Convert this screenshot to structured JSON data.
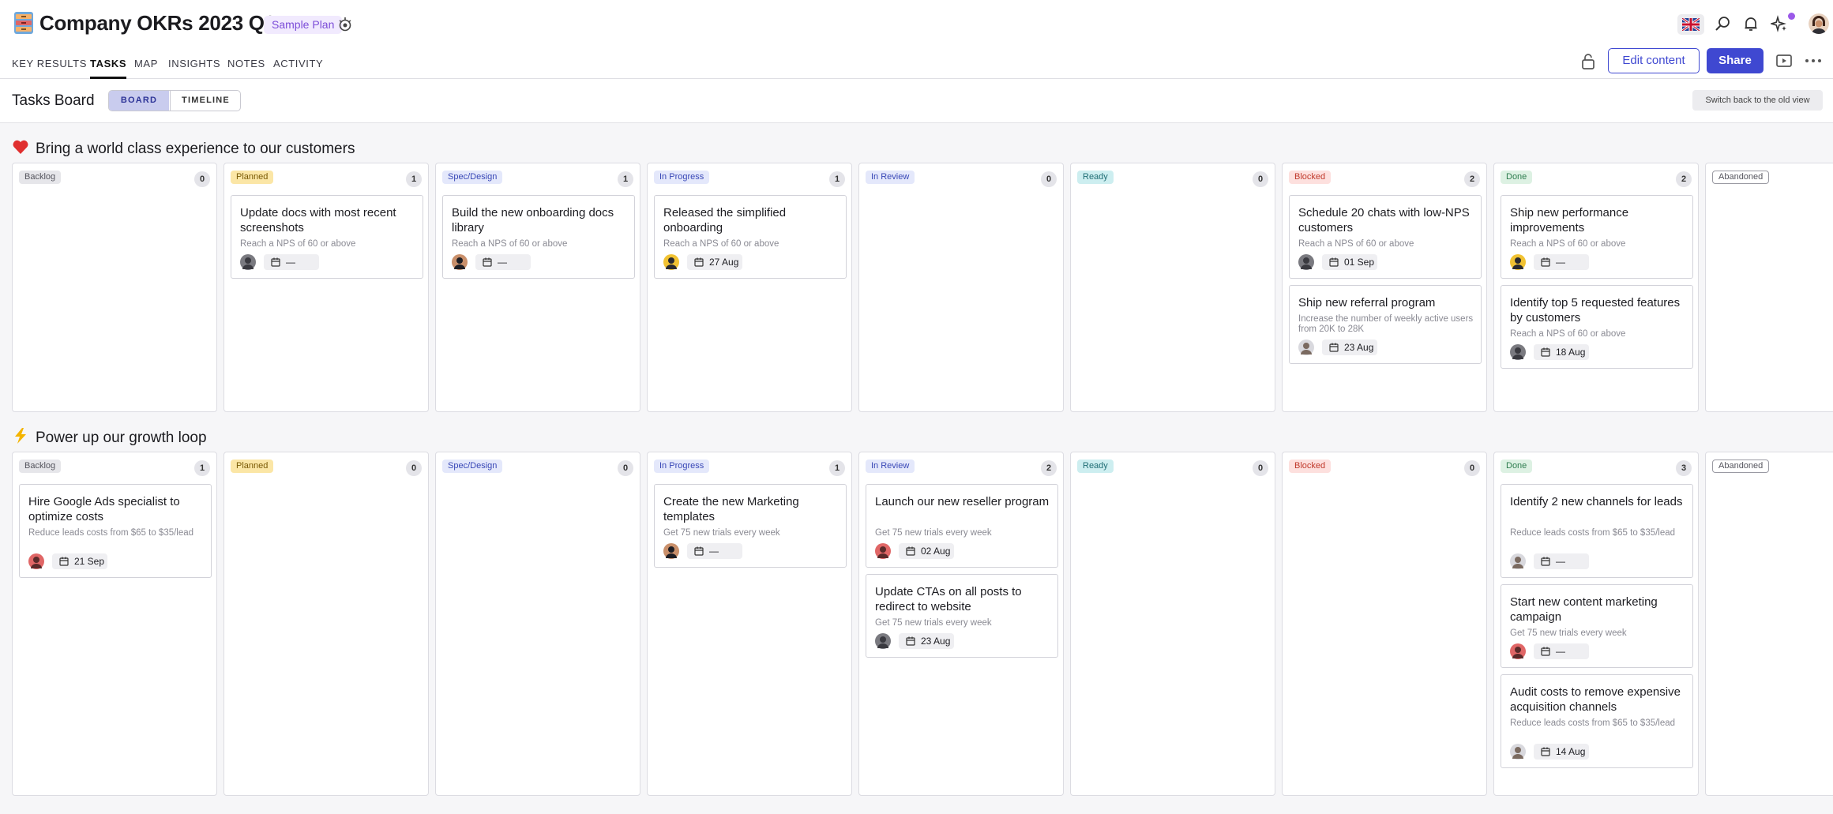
{
  "header": {
    "plan_emoji": "file-cabinet-icon",
    "title": "Company OKRs 2023 Q3",
    "badge": "Sample Plan"
  },
  "tabs": [
    {
      "label": "KEY RESULTS"
    },
    {
      "label": "TASKS",
      "active": true
    },
    {
      "label": "MAP"
    },
    {
      "label": "INSIGHTS"
    },
    {
      "label": "NOTES"
    },
    {
      "label": "ACTIVITY"
    }
  ],
  "actions": {
    "edit": "Edit content",
    "share": "Share"
  },
  "board": {
    "title": "Tasks Board",
    "views": [
      {
        "label": "BOARD",
        "active": true
      },
      {
        "label": "TIMELINE"
      }
    ],
    "switch_old": "Switch back to the old view"
  },
  "colors": {
    "accent": "#3f48d1",
    "badge_bg": "#f1eafe",
    "badge_text": "#7c4dd8"
  },
  "status_styles": {
    "Backlog": {
      "bg": "#e6e6ea",
      "fg": "#55555e"
    },
    "Planned": {
      "bg": "#fbe6a6",
      "fg": "#7a5a06"
    },
    "Spec/Design": {
      "bg": "#e4e8fb",
      "fg": "#3847b6"
    },
    "In Progress": {
      "bg": "#e4e8fb",
      "fg": "#3847b6"
    },
    "In Review": {
      "bg": "#e4e8fb",
      "fg": "#3847b6"
    },
    "Ready": {
      "bg": "#cdeef0",
      "fg": "#1f6d74"
    },
    "Blocked": {
      "bg": "#fde0de",
      "fg": "#c0392b"
    },
    "Done": {
      "bg": "#ddf1e3",
      "fg": "#2e7d4f"
    },
    "Abandoned": {
      "bg": "#ffffff",
      "fg": "#55555e",
      "outline": true
    }
  },
  "objectives": [
    {
      "icon": "heart-icon",
      "title": "Bring a world class experience to our customers",
      "columns": [
        {
          "status": "Backlog",
          "count": "0",
          "cards": []
        },
        {
          "status": "Planned",
          "count": "1",
          "cards": [
            {
              "title": "Update docs with most recent screenshots",
              "kr": "Reach a NPS of 60 or above",
              "date": "—",
              "avatar": "gray"
            }
          ]
        },
        {
          "status": "Spec/Design",
          "count": "1",
          "cards": [
            {
              "title": "Build the new onboarding docs library",
              "kr": "Reach a NPS of 60 or above",
              "date": "—",
              "avatar": "dark"
            }
          ]
        },
        {
          "status": "In Progress",
          "count": "1",
          "cards": [
            {
              "title": "Released the simplified onboarding",
              "kr": "Reach a NPS of 60 or above",
              "date": "27 Aug",
              "avatar": "yellow"
            }
          ]
        },
        {
          "status": "In Review",
          "count": "0",
          "cards": []
        },
        {
          "status": "Ready",
          "count": "0",
          "cards": []
        },
        {
          "status": "Blocked",
          "count": "2",
          "cards": [
            {
              "title": "Schedule 20 chats with low-NPS customers",
              "kr": "Reach a NPS of 60 or above",
              "date": "01 Sep",
              "avatar": "gray"
            },
            {
              "title": "Ship new referral program",
              "kr": "Increase the number of weekly active users from 20K to 28K",
              "date": "23 Aug",
              "avatar": "light"
            }
          ]
        },
        {
          "status": "Done",
          "count": "2",
          "cards": [
            {
              "title": "Ship new performance improvements",
              "kr": "Reach a NPS of 60 or above",
              "date": "—",
              "avatar": "yellow"
            },
            {
              "title": "Identify top 5 requested features by customers",
              "kr": "Reach a NPS of 60 or above",
              "date": "18 Aug",
              "avatar": "gray"
            }
          ]
        },
        {
          "status": "Abandoned",
          "count": "",
          "cards": []
        }
      ]
    },
    {
      "icon": "lightning-icon",
      "title": "Power up our growth loop",
      "columns": [
        {
          "status": "Backlog",
          "count": "1",
          "cards": [
            {
              "title": "Hire Google Ads specialist to optimize costs",
              "kr": "Reduce leads costs from $65 to $35/lead",
              "date": "21 Sep",
              "avatar": "red"
            }
          ]
        },
        {
          "status": "Planned",
          "count": "0",
          "cards": []
        },
        {
          "status": "Spec/Design",
          "count": "0",
          "cards": []
        },
        {
          "status": "In Progress",
          "count": "1",
          "cards": [
            {
              "title": "Create the new Marketing templates",
              "kr": "Get 75 new trials every week",
              "date": "—",
              "avatar": "dark"
            }
          ]
        },
        {
          "status": "In Review",
          "count": "2",
          "cards": [
            {
              "title": "Launch our new reseller program",
              "kr": "Get 75 new trials every week",
              "date": "02 Aug",
              "avatar": "red"
            },
            {
              "title": "Update CTAs on all posts to redirect to website",
              "kr": "Get 75 new trials every week",
              "date": "23 Aug",
              "avatar": "gray"
            }
          ]
        },
        {
          "status": "Ready",
          "count": "0",
          "cards": []
        },
        {
          "status": "Blocked",
          "count": "0",
          "cards": []
        },
        {
          "status": "Done",
          "count": "3",
          "cards": [
            {
              "title": "Identify 2 new channels for leads",
              "kr": "Reduce leads costs from $65 to $35/lead",
              "date": "—",
              "avatar": "light"
            },
            {
              "title": "Start new content marketing campaign",
              "kr": "Get 75 new trials every week",
              "date": "—",
              "avatar": "red"
            },
            {
              "title": "Audit costs to remove expensive acquisition channels",
              "kr": "Reduce leads costs from $65 to $35/lead",
              "date": "14 Aug",
              "avatar": "light"
            }
          ]
        },
        {
          "status": "Abandoned",
          "count": "",
          "cards": []
        }
      ]
    }
  ]
}
